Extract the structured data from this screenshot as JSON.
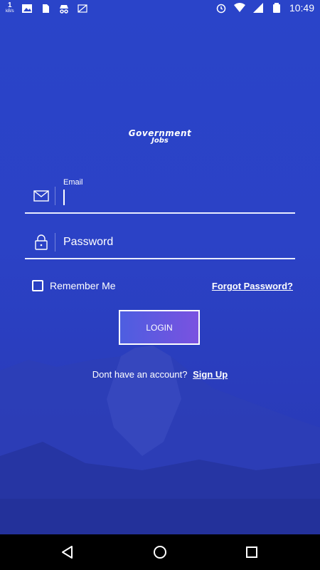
{
  "status_bar": {
    "speed_value": "1",
    "speed_unit": "kB/s",
    "time": "10:49"
  },
  "logo": {
    "line1": "Government",
    "line2": "Jobs"
  },
  "email": {
    "label": "Email"
  },
  "password": {
    "placeholder": "Password"
  },
  "remember_me": "Remember Me",
  "forgot_password": "Forgot Password?",
  "login_button": "LOGIN",
  "signup": {
    "prompt": "Dont have an account?",
    "link": "Sign Up"
  },
  "colors": {
    "background": "#2a41c4",
    "button_gradient_start": "#4d5ee0",
    "button_gradient_end": "#7a52e0"
  },
  "icons": [
    "image-icon",
    "sim-icon",
    "incognito-icon",
    "no-sim-icon",
    "alarm-icon",
    "wifi-icon",
    "signal-icon",
    "battery-icon",
    "mail-icon",
    "lock-icon",
    "back-icon",
    "home-icon",
    "recents-icon"
  ]
}
